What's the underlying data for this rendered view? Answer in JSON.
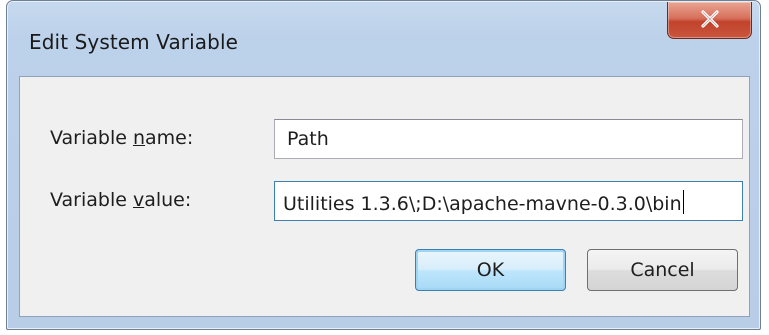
{
  "window": {
    "title": "Edit System Variable"
  },
  "titlebar": {
    "close_icon": "close-x-icon"
  },
  "form": {
    "name_label_prefix": "Variable ",
    "name_label_access_key": "n",
    "name_label_suffix": "ame:",
    "name_value": "Path",
    "value_label_prefix": "Variable ",
    "value_label_access_key": "v",
    "value_label_suffix": "alue:",
    "value_value": "Utilities 1.3.6\\;D:\\apache-mavne-0.3.0\\bin"
  },
  "buttons": {
    "ok_label": "OK",
    "cancel_label": "Cancel"
  },
  "colors": {
    "titlebar": "#bcd1ea",
    "close_button": "#c9563d",
    "dialog_body": "#f0f0f0",
    "default_button_border": "#3c7fb1"
  }
}
